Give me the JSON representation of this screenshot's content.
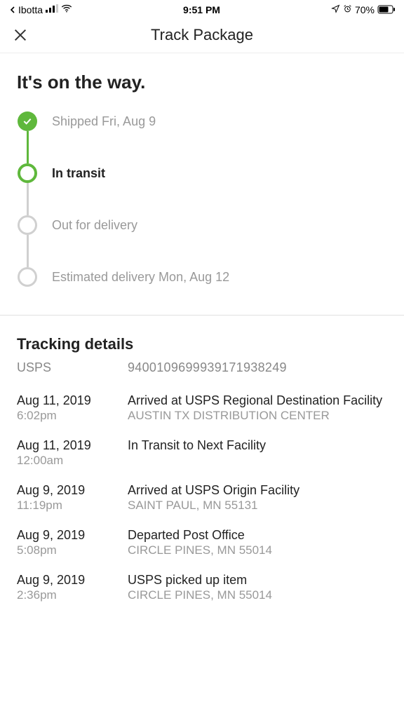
{
  "status_bar": {
    "back_app": "Ibotta",
    "time": "9:51 PM",
    "battery_pct": "70%"
  },
  "nav": {
    "title": "Track Package"
  },
  "headline": "It's on the way.",
  "timeline": {
    "shipped": "Shipped Fri, Aug 9",
    "in_transit": "In transit",
    "out_for_delivery": "Out for delivery",
    "estimated": "Estimated delivery Mon, Aug 12"
  },
  "details": {
    "title": "Tracking details",
    "carrier": "USPS",
    "tracking_number": "9400109699939171938249",
    "events": [
      {
        "date": "Aug 11, 2019",
        "time": "6:02pm",
        "status": "Arrived at USPS Regional Destination Facility",
        "location": "AUSTIN TX DISTRIBUTION CENTER"
      },
      {
        "date": "Aug 11, 2019",
        "time": "12:00am",
        "status": "In Transit to Next Facility",
        "location": ""
      },
      {
        "date": "Aug 9, 2019",
        "time": "11:19pm",
        "status": "Arrived at USPS Origin Facility",
        "location": "SAINT PAUL, MN 55131"
      },
      {
        "date": "Aug 9, 2019",
        "time": "5:08pm",
        "status": "Departed Post Office",
        "location": "CIRCLE PINES, MN 55014"
      },
      {
        "date": "Aug 9, 2019",
        "time": "2:36pm",
        "status": "USPS picked up item",
        "location": "CIRCLE PINES, MN 55014"
      }
    ]
  }
}
